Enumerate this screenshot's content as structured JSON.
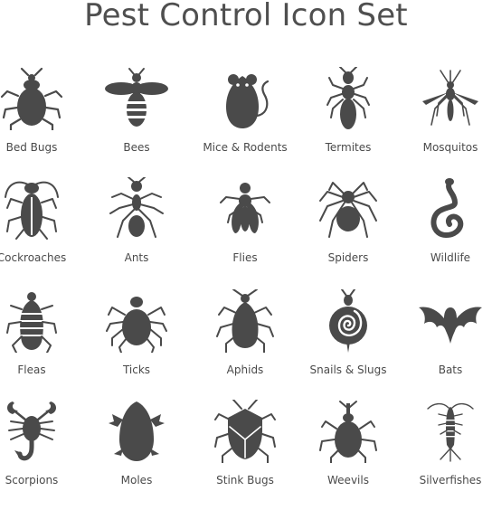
{
  "title": "Pest Control Icon Set",
  "ink_color": "#4a4a4a",
  "icons": [
    {
      "label": "Bed Bugs",
      "icon": "bed-bug-icon"
    },
    {
      "label": "Bees",
      "icon": "bee-icon"
    },
    {
      "label": "Mice & Rodents",
      "icon": "mouse-icon"
    },
    {
      "label": "Termites",
      "icon": "termite-icon"
    },
    {
      "label": "Mosquitos",
      "icon": "mosquito-icon"
    },
    {
      "label": "Cockroaches",
      "icon": "cockroach-icon"
    },
    {
      "label": "Ants",
      "icon": "ant-icon"
    },
    {
      "label": "Flies",
      "icon": "fly-icon"
    },
    {
      "label": "Spiders",
      "icon": "spider-icon"
    },
    {
      "label": "Wildlife",
      "icon": "snake-icon"
    },
    {
      "label": "Fleas",
      "icon": "flea-icon"
    },
    {
      "label": "Ticks",
      "icon": "tick-icon"
    },
    {
      "label": "Aphids",
      "icon": "aphid-icon"
    },
    {
      "label": "Snails & Slugs",
      "icon": "snail-icon"
    },
    {
      "label": "Bats",
      "icon": "bat-icon"
    },
    {
      "label": "Scorpions",
      "icon": "scorpion-icon"
    },
    {
      "label": "Moles",
      "icon": "mole-icon"
    },
    {
      "label": "Stink Bugs",
      "icon": "stink-bug-icon"
    },
    {
      "label": "Weevils",
      "icon": "weevil-icon"
    },
    {
      "label": "Silverfishes",
      "icon": "silverfish-icon"
    }
  ]
}
